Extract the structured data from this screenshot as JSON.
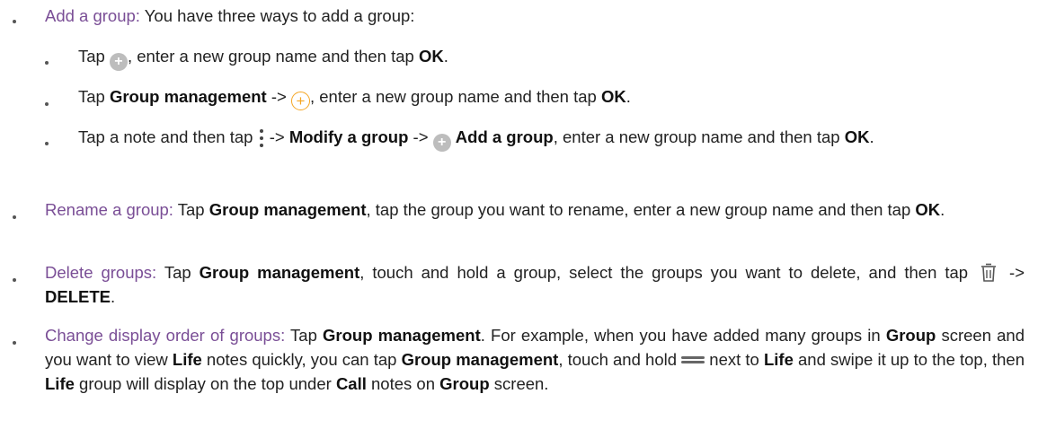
{
  "items": {
    "add": {
      "term": "Add a group:",
      "lead": " You have three ways to add a group:",
      "subs": {
        "s1": {
          "a": "Tap ",
          "b": ", enter a new group name and then tap ",
          "ok": "OK",
          "end": "."
        },
        "s2": {
          "a": "Tap ",
          "gm": "Group management",
          "arrow": " -> ",
          "b": ", enter a new group name and then tap ",
          "ok": "OK",
          "end": "."
        },
        "s3": {
          "a": "Tap a note and then tap ",
          "arrow1": " -> ",
          "mod": "Modify a group",
          "arrow2": " -> ",
          "add": "Add a group",
          "b": ", enter a new group name and then tap ",
          "ok": "OK",
          "end": "."
        }
      }
    },
    "rename": {
      "term": "Rename a group:",
      "a": " Tap ",
      "gm": "Group management",
      "b": ", tap the group you want to rename, enter a new group name and then tap ",
      "ok": "OK",
      "end": "."
    },
    "delete": {
      "term": "Delete groups:",
      "a": " Tap ",
      "gm": "Group management",
      "b": ", touch and hold a group, select the groups you want to delete, and then tap ",
      "arrow": " -> ",
      "del": "DELETE",
      "end": "."
    },
    "order": {
      "term": "Change display order of groups:",
      "a": " Tap ",
      "gm": "Group management",
      "b": ". For example, when you have added many groups in ",
      "group": "Group",
      "c": " screen and you want to view ",
      "life": "Life",
      "d": " notes quickly, you can tap ",
      "gm2": "Group management",
      "e": ", touch and hold ",
      "f": " next to ",
      "life2": "Life",
      "g": " and swipe it up to the top, then ",
      "life3": "Life",
      "h": " group will display on the top under ",
      "call": "Call",
      "i": " notes on ",
      "group2": "Group",
      "j": " screen."
    }
  },
  "icons": {
    "add_fill": "plus-circle-filled-icon",
    "add_outline": "plus-circle-outline-icon",
    "more": "more-vertical-icon",
    "delete": "trash-icon",
    "drag": "drag-handle-icon"
  },
  "colors": {
    "term": "#7a4e96",
    "accent_outline": "#f5a623",
    "icon_fill": "#bdbdbd"
  }
}
